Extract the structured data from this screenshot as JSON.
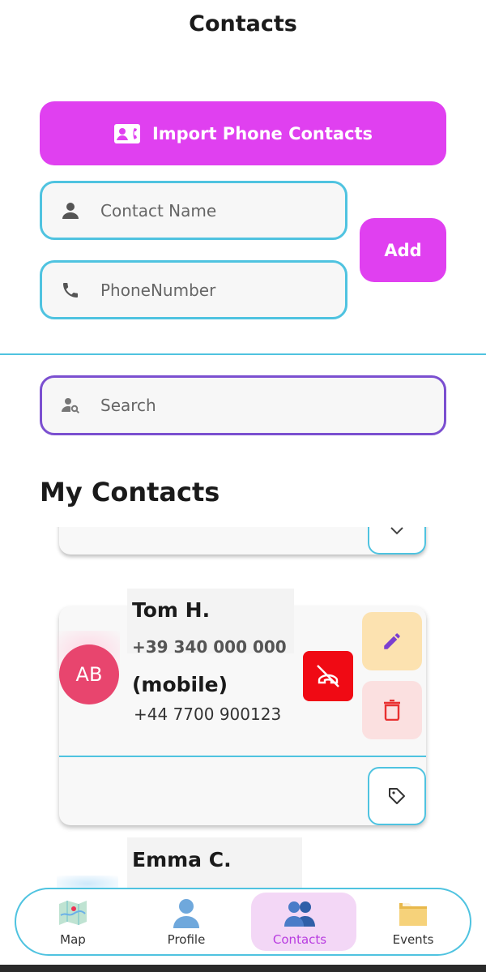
{
  "header": {
    "title": "Contacts"
  },
  "import_button": {
    "label": "Import Phone Contacts"
  },
  "form": {
    "name_placeholder": "Contact Name",
    "phone_placeholder": "PhoneNumber",
    "add_label": "Add"
  },
  "search": {
    "placeholder": "Search"
  },
  "section": {
    "title": "My Contacts"
  },
  "contacts": [
    {
      "initials": "AB",
      "name": "Tom H.",
      "phone_primary": "+39 340 000 000",
      "phone_type": "(mobile)",
      "phone_secondary": "+44 7700 900123"
    },
    {
      "name": "Emma C."
    }
  ],
  "colors": {
    "accent": "#e040f0",
    "border": "#4fc3e0",
    "search_border": "#7b4fd0",
    "avatar": "#e8456e",
    "no_call": "#f00a14"
  },
  "nav": {
    "items": [
      {
        "label": "Map",
        "icon": "map-icon"
      },
      {
        "label": "Profile",
        "icon": "profile-icon"
      },
      {
        "label": "Contacts",
        "icon": "contacts-icon"
      },
      {
        "label": "Events",
        "icon": "folder-icon"
      }
    ]
  }
}
